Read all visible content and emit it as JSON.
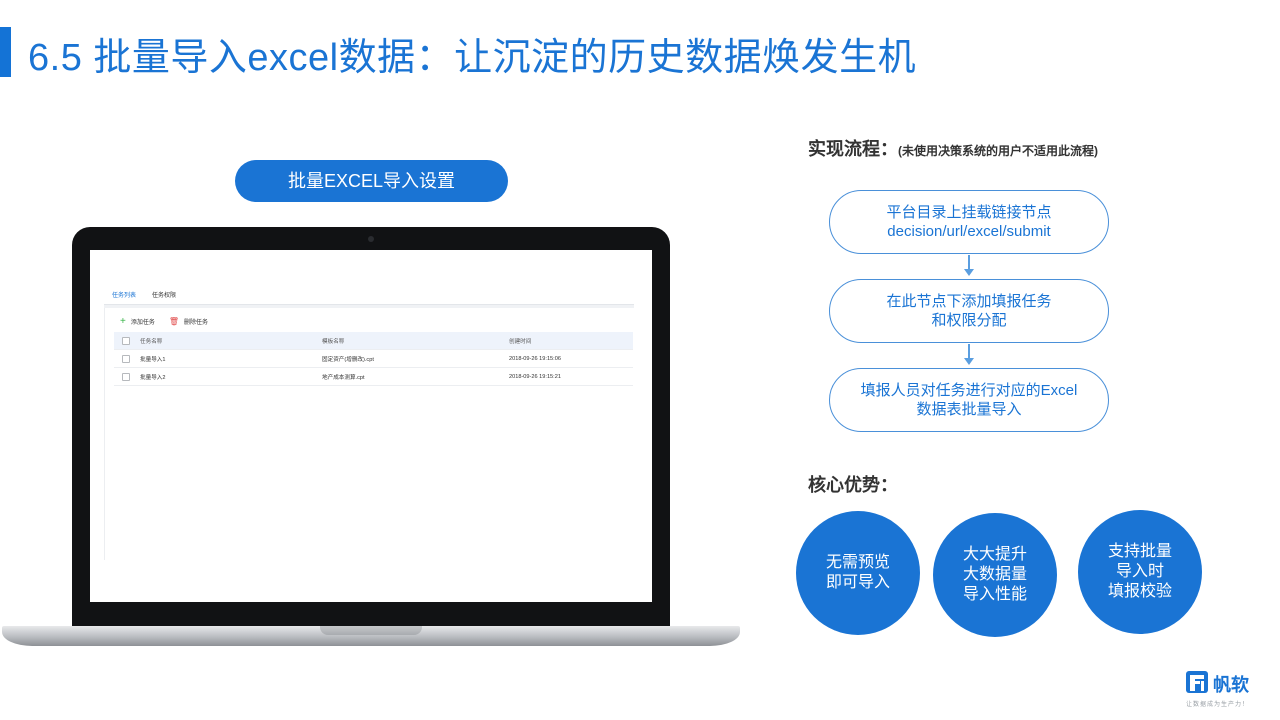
{
  "slide": {
    "title": "6.5  批量导入excel数据：让沉淀的历史数据焕发生机",
    "pill": "批量EXCEL导入设置",
    "accent_color": "#1a74d4"
  },
  "screen": {
    "tabs": [
      "任务列表",
      "任务权限"
    ],
    "toolbar": {
      "add": "添加任务",
      "delete": "删除任务"
    },
    "table": {
      "columns": [
        "任务名称",
        "模板名称",
        "创建时间"
      ],
      "rows": [
        [
          "批量导入1",
          "固定资产(增删改).cpt",
          "2018-09-26 19:15:06"
        ],
        [
          "批量导入2",
          "地产成本测算.cpt",
          "2018-09-26 19:15:21"
        ]
      ]
    }
  },
  "process": {
    "heading": "实现流程：",
    "note": "(未使用决策系统的用户不适用此流程)",
    "steps": [
      {
        "line1": "平台目录上挂载链接节点",
        "line2": "decision/url/excel/submit"
      },
      {
        "line1": "在此节点下添加填报任务",
        "line2": "和权限分配"
      },
      {
        "line1": "填报人员对任务进行对应的Excel",
        "line2": "数据表批量导入"
      }
    ]
  },
  "advantages": {
    "heading": "核心优势：",
    "items": [
      {
        "line1": "无需预览",
        "line2": "即可导入",
        "line3": ""
      },
      {
        "line1": "大大提升",
        "line2": "大数据量",
        "line3": "导入性能"
      },
      {
        "line1": "支持批量",
        "line2": "导入时",
        "line3": "填报校验"
      }
    ]
  },
  "logo": {
    "name": "帆软",
    "tagline": "让数据成为生产力！",
    "icon": "fanruan-logo-icon"
  }
}
